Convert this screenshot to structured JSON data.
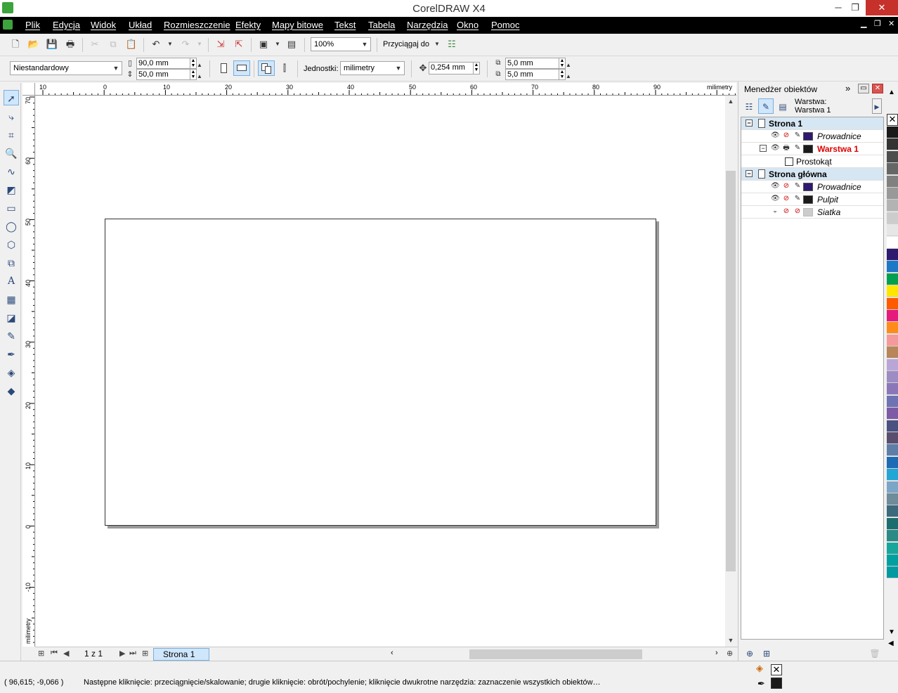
{
  "app": {
    "title": "CorelDRAW X4"
  },
  "window_controls": {
    "minimize": "─",
    "maximize": "❐",
    "close": "✕"
  },
  "menu": {
    "items": [
      "Plik",
      "Edycja",
      "Widok",
      "Układ",
      "Rozmieszczenie",
      "Efekty",
      "Mapy bitowe",
      "Tekst",
      "Tabela",
      "Narzędzia",
      "Okno",
      "Pomoc"
    ]
  },
  "standard_toolbar": {
    "zoom_value": "100%",
    "snap_label": "Przyciągaj do"
  },
  "property_bar": {
    "paper_type": "Niestandardowy",
    "width": "90,0 mm",
    "height": "50,0 mm",
    "units_label": "Jednostki:",
    "units_value": "milimetry",
    "nudge": "0,254 mm",
    "dup_x": "5,0 mm",
    "dup_y": "5,0 mm"
  },
  "rulers": {
    "horizontal_labels": [
      "10",
      "0",
      "10",
      "20",
      "30",
      "40",
      "50",
      "60",
      "70",
      "80",
      "90"
    ],
    "horizontal_unit": "milimetry",
    "vertical_labels": [
      "70",
      "60",
      "50",
      "40",
      "30",
      "20",
      "10",
      "0",
      "-10"
    ],
    "vertical_unit": "milimetry"
  },
  "page_nav": {
    "counter": "1 z 1",
    "tab": "Strona 1"
  },
  "docker": {
    "title": "Menedżer obiektów",
    "layer_caption": "Warstwa:",
    "layer_value": "Warstwa 1",
    "tree": {
      "page1": "Strona 1",
      "page1_layers": [
        "Prowadnice",
        "Warstwa 1"
      ],
      "object": "Prostokąt",
      "master": "Strona główna",
      "master_layers": [
        "Prowadnice",
        "Pulpit",
        "Siatka"
      ]
    }
  },
  "palette": {
    "colors": [
      "#1a1a1a",
      "#333333",
      "#4d4d4d",
      "#666666",
      "#808080",
      "#999999",
      "#b3b3b3",
      "#cccccc",
      "#e6e6e6",
      "#ffffff",
      "#2e1a6e",
      "#1e78c8",
      "#00a050",
      "#ffe600",
      "#ff5a00",
      "#e6197d",
      "#ff8c1a",
      "#f59a9a",
      "#b8865a",
      "#b9a6d6",
      "#9d8cc4",
      "#8b77b8",
      "#6e73b4",
      "#7d5aa6",
      "#4a5080",
      "#5a4e6e",
      "#5e7ea8",
      "#1d6bb5",
      "#22a6d6",
      "#7ca6c8",
      "#6e8c9a",
      "#3a6a7c",
      "#1c6e6e",
      "#2a8a86",
      "#17a69c",
      "#00a0a0",
      "#009aa0"
    ]
  },
  "status": {
    "coords": "( 96,615; -9,066 )",
    "hint": "Następne kliknięcie: przeciągnięcie/skalowanie; drugie kliknięcie: obrót/pochylenie; kliknięcie dwukrotne narzędzia: zaznaczenie wszystkich obiektów…",
    "fill_color": "#ffffff",
    "outline_color": "#1a1a1a"
  }
}
